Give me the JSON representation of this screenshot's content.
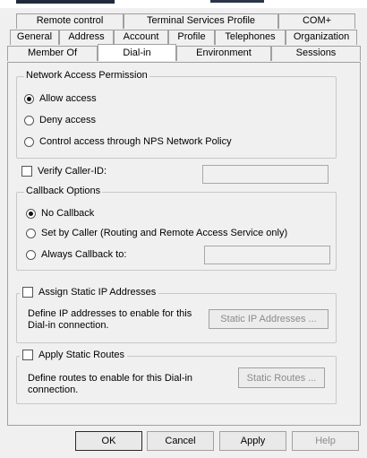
{
  "tabs": {
    "row1": [
      {
        "label": "Remote control"
      },
      {
        "label": "Terminal Services Profile"
      },
      {
        "label": "COM+"
      }
    ],
    "row2": [
      {
        "label": "General"
      },
      {
        "label": "Address"
      },
      {
        "label": "Account"
      },
      {
        "label": "Profile"
      },
      {
        "label": "Telephones"
      },
      {
        "label": "Organization"
      }
    ],
    "row3": [
      {
        "label": "Member Of"
      },
      {
        "label": "Dial-in"
      },
      {
        "label": "Environment"
      },
      {
        "label": "Sessions"
      }
    ],
    "active": "Dial-in"
  },
  "network_access": {
    "legend": "Network Access Permission",
    "options": [
      {
        "label": "Allow access",
        "selected": true
      },
      {
        "label": "Deny access",
        "selected": false
      },
      {
        "label": "Control access through NPS Network Policy",
        "selected": false
      }
    ]
  },
  "verify_caller_id": {
    "label": "Verify Caller-ID:",
    "checked": false,
    "value": ""
  },
  "callback": {
    "legend": "Callback Options",
    "options": [
      {
        "label": "No Callback",
        "selected": true
      },
      {
        "label": "Set by Caller (Routing and Remote Access Service only)",
        "selected": false
      },
      {
        "label": "Always Callback to:",
        "selected": false
      }
    ],
    "callback_number": ""
  },
  "static_ip": {
    "label": "Assign Static IP Addresses",
    "checked": false,
    "description_line1": "Define IP addresses to enable for this",
    "description_line2": "Dial-in connection.",
    "button": "Static IP Addresses ..."
  },
  "static_routes": {
    "label": "Apply Static Routes",
    "checked": false,
    "description_line1": "Define routes to enable for this Dial-in",
    "description_line2": "connection.",
    "button": "Static Routes ..."
  },
  "footer": {
    "ok": "OK",
    "cancel": "Cancel",
    "apply": "Apply",
    "help": "Help"
  }
}
